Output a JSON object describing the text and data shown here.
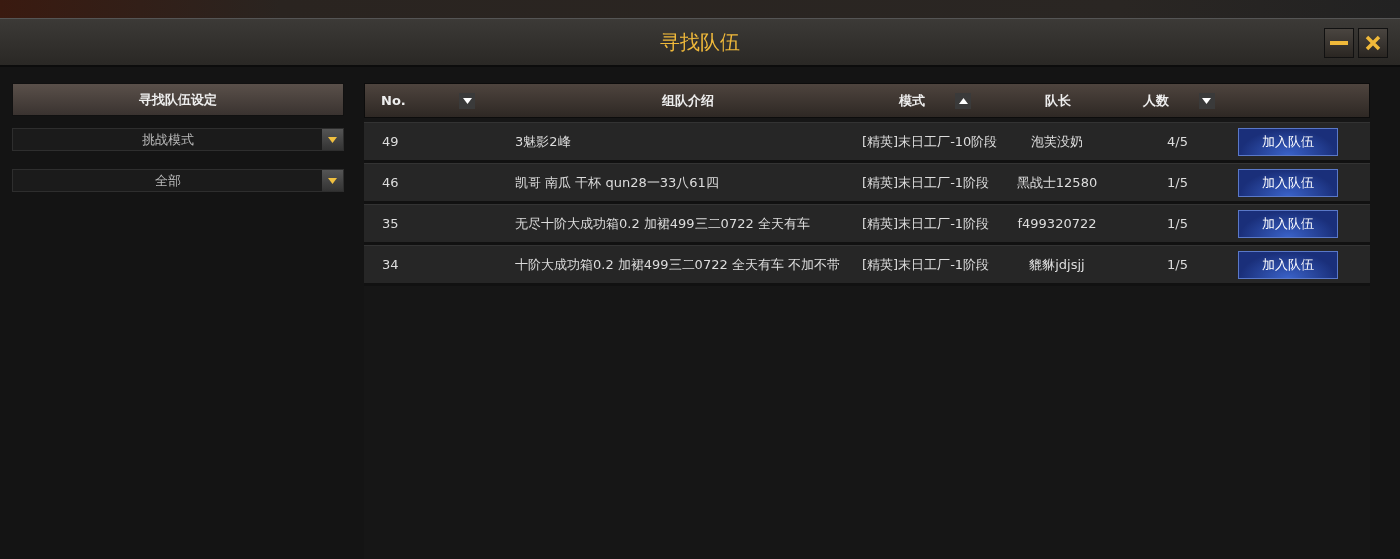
{
  "window": {
    "title": "寻找队伍"
  },
  "title_buttons": [
    {
      "kind": "minimize"
    },
    {
      "kind": "close"
    }
  ],
  "sidebar": {
    "heading": "寻找队伍设定",
    "dropdowns": [
      {
        "value": "挑战模式"
      },
      {
        "value": "全部"
      }
    ]
  },
  "table": {
    "columns": [
      {
        "label": "No.",
        "sortable": true,
        "ascending": false
      },
      {
        "label": "组队介绍",
        "sortable": false
      },
      {
        "label": "模式",
        "sortable": true,
        "ascending": true
      },
      {
        "label": "队长",
        "sortable": false
      },
      {
        "label": "人数",
        "sortable": true,
        "ascending": false
      }
    ],
    "rows": [
      {
        "no": "49",
        "intro": "3魅影2峰",
        "mode": "[精英]末日工厂-10阶段",
        "leader": "泡芙没奶",
        "members": "4/5",
        "action": "加入队伍"
      },
      {
        "no": "46",
        "intro": "凯哥 南瓜 干杯  qun28一33八61四",
        "mode": "[精英]末日工厂-1阶段",
        "leader": "黑战士12580",
        "members": "1/5",
        "action": "加入队伍"
      },
      {
        "no": "35",
        "intro": "无尽十阶大成功箱0.2 加裙499三二0722 全天有车",
        "mode": "[精英]末日工厂-1阶段",
        "leader": "f499320722",
        "members": "1/5",
        "action": "加入队伍"
      },
      {
        "no": "34",
        "intro": "十阶大成功箱0.2 加裙499三二0722 全天有车 不加不带",
        "mode": "[精英]末日工厂-1阶段",
        "leader": "貔貅jdjsjj",
        "members": "1/5",
        "action": "加入队伍"
      }
    ]
  }
}
